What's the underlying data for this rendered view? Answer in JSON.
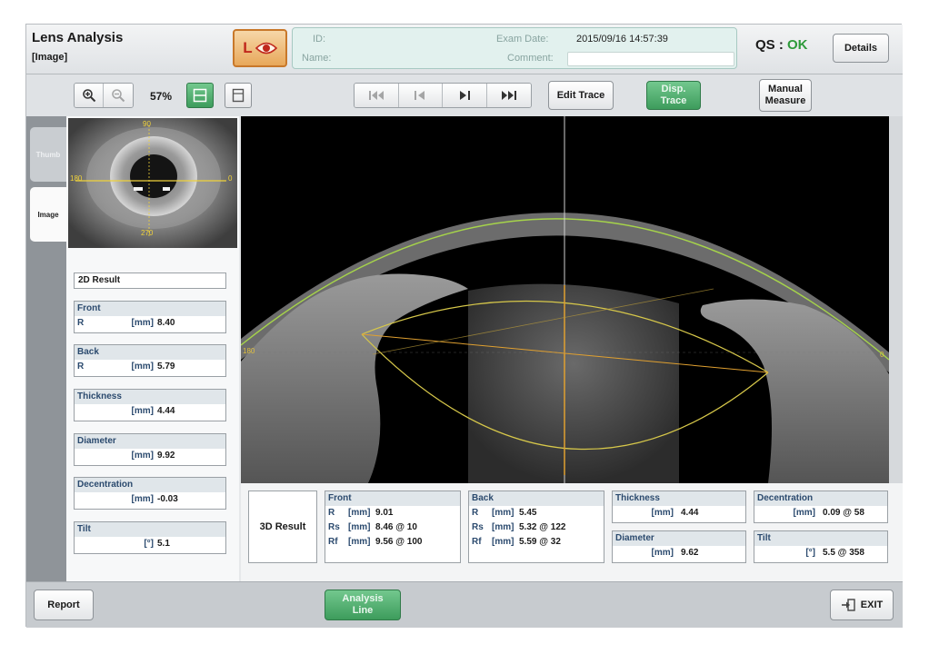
{
  "header": {
    "title": "Lens Analysis",
    "subtitle": "[Image]",
    "eye": "L",
    "id_label": "ID:",
    "name_label": "Name:",
    "exam_date_label": "Exam Date:",
    "exam_date": "2015/09/16 14:57:39",
    "comment_label": "Comment:",
    "qs_label": "QS :",
    "qs_value": "OK",
    "details_label": "Details"
  },
  "toolbar": {
    "zoom_percent": "57%",
    "edit_trace_label": "Edit Trace",
    "disp_trace_label_1": "Disp.",
    "disp_trace_label_2": "Trace",
    "manual_measure_label_1": "Manual",
    "manual_measure_label_2": "Measure"
  },
  "tabs": {
    "thumb_label": "Thumb",
    "image_label": "Image"
  },
  "thumbnail": {
    "top_label": "90",
    "bottom_label": "270",
    "left_label": "180",
    "right_label": "0"
  },
  "results_2d": {
    "title": "2D Result",
    "front": {
      "label": "Front",
      "sub": "R",
      "unit": "[mm]",
      "value": "8.40"
    },
    "back": {
      "label": "Back",
      "sub": "R",
      "unit": "[mm]",
      "value": "5.79"
    },
    "thickness": {
      "label": "Thickness",
      "unit": "[mm]",
      "value": "4.44"
    },
    "diameter": {
      "label": "Diameter",
      "unit": "[mm]",
      "value": "9.92"
    },
    "decentration": {
      "label": "Decentration",
      "unit": "[mm]",
      "value": "-0.03"
    },
    "tilt": {
      "label": "Tilt",
      "unit": "[°]",
      "value": "5.1"
    }
  },
  "results_3d": {
    "title": "3D Result",
    "front": {
      "label": "Front",
      "rows": [
        {
          "name": "R",
          "unit": "[mm]",
          "value": "9.01"
        },
        {
          "name": "Rs",
          "unit": "[mm]",
          "value": "8.46 @ 10"
        },
        {
          "name": "Rf",
          "unit": "[mm]",
          "value": "9.56 @ 100"
        }
      ]
    },
    "back": {
      "label": "Back",
      "rows": [
        {
          "name": "R",
          "unit": "[mm]",
          "value": "5.45"
        },
        {
          "name": "Rs",
          "unit": "[mm]",
          "value": "5.32 @ 122"
        },
        {
          "name": "Rf",
          "unit": "[mm]",
          "value": "5.59 @ 32"
        }
      ]
    },
    "thickness": {
      "label": "Thickness",
      "unit": "[mm]",
      "value": "4.44"
    },
    "diameter": {
      "label": "Diameter",
      "unit": "[mm]",
      "value": "9.62"
    },
    "decentration": {
      "label": "Decentration",
      "unit": "[mm]",
      "value": "0.09 @ 58"
    },
    "tilt": {
      "label": "Tilt",
      "unit": "[°]",
      "value": "5.5 @ 358"
    }
  },
  "footer": {
    "report_label": "Report",
    "analysis_line_label_1": "Analysis",
    "analysis_line_label_2": "Line",
    "exit_label": "EXIT"
  },
  "scan_labels": {
    "left_marker": "180",
    "right_marker": "0"
  }
}
